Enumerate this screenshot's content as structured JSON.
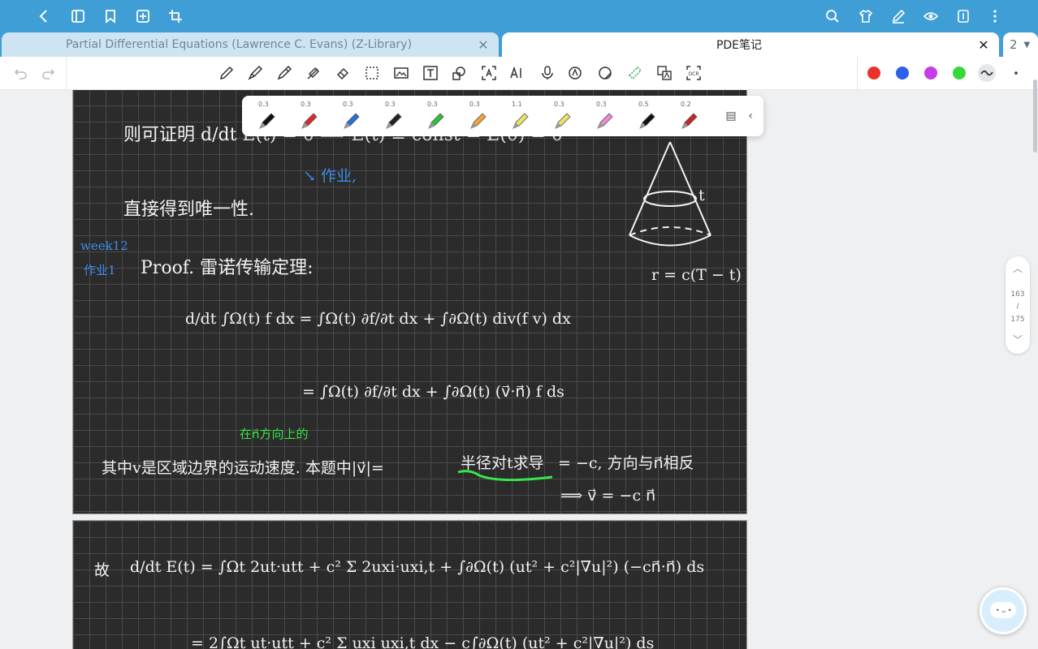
{
  "tabs": {
    "left_title": "Partial Differential Equations (Lawrence C. Evans) (Z-Library)",
    "right_title": "PDE笔记",
    "extra_count": "2"
  },
  "pen_sizes": [
    "0.3",
    "0.3",
    "0.3",
    "0.3",
    "0.3",
    "0.3",
    "1.1",
    "0.3",
    "0.3",
    "0.5",
    "0.2"
  ],
  "pen_colors": [
    "#111111",
    "#d92b2b",
    "#2a6fd6",
    "#222222",
    "#2fbf3a",
    "#f0a43a",
    "#e8e26a",
    "#e8e26a",
    "#e88ad6",
    "#111111",
    "#c42525"
  ],
  "color_dots": [
    "#e8322b",
    "#2d60e8",
    "#c63ce8",
    "#37d83c"
  ],
  "pager": {
    "current": "163",
    "slash": "/",
    "total": "175"
  },
  "notes": {
    "line_proof_intro": "则可证明 d/dt E(t) = 0 ⟹ E(t) ≡ const = E(0) = 0",
    "homework": "↘ 作业,",
    "uniqueness": "直接得到唯一性.",
    "week": "week12",
    "homework2": "作业1",
    "proof": "Proof.   雷诺传输定理:",
    "eq1_lhs": "d/dt ∫Ω(t) f dx = ∫Ω(t) ∂f/∂t dx + ∫∂Ω(t) div(f v) dx",
    "eq2": "= ∫Ω(t) ∂f/∂t dx + ∫∂Ω(t) (v⃗·n⃗) f ds",
    "annotation_direction": "在n⃗方向上的",
    "explanation": "其中v是区域边界的运动速度. 本题中|v⃗|=",
    "half_diameter": "半径对t求导",
    "explanation2": "= −c, 方向与n⃗相反",
    "velocity": "⟹ v⃗ = −c n⃗",
    "cone_label_t": "t",
    "cone_radius": "r = c(T − t)",
    "page2_line1_prefix": "故",
    "page2_line1": "d/dt E(t) = ∫Ωt 2ut·utt + c² Σ 2uxi·uxi,t + ∫∂Ω(t) (ut² + c²|∇u|²) (−cn⃗·n⃗) ds",
    "page2_line2": "= 2∫Ωt ut·utt + c² Σ uxi uxi,t dx − c∫∂Ω(t) (ut² + c²|∇u|²) ds"
  }
}
